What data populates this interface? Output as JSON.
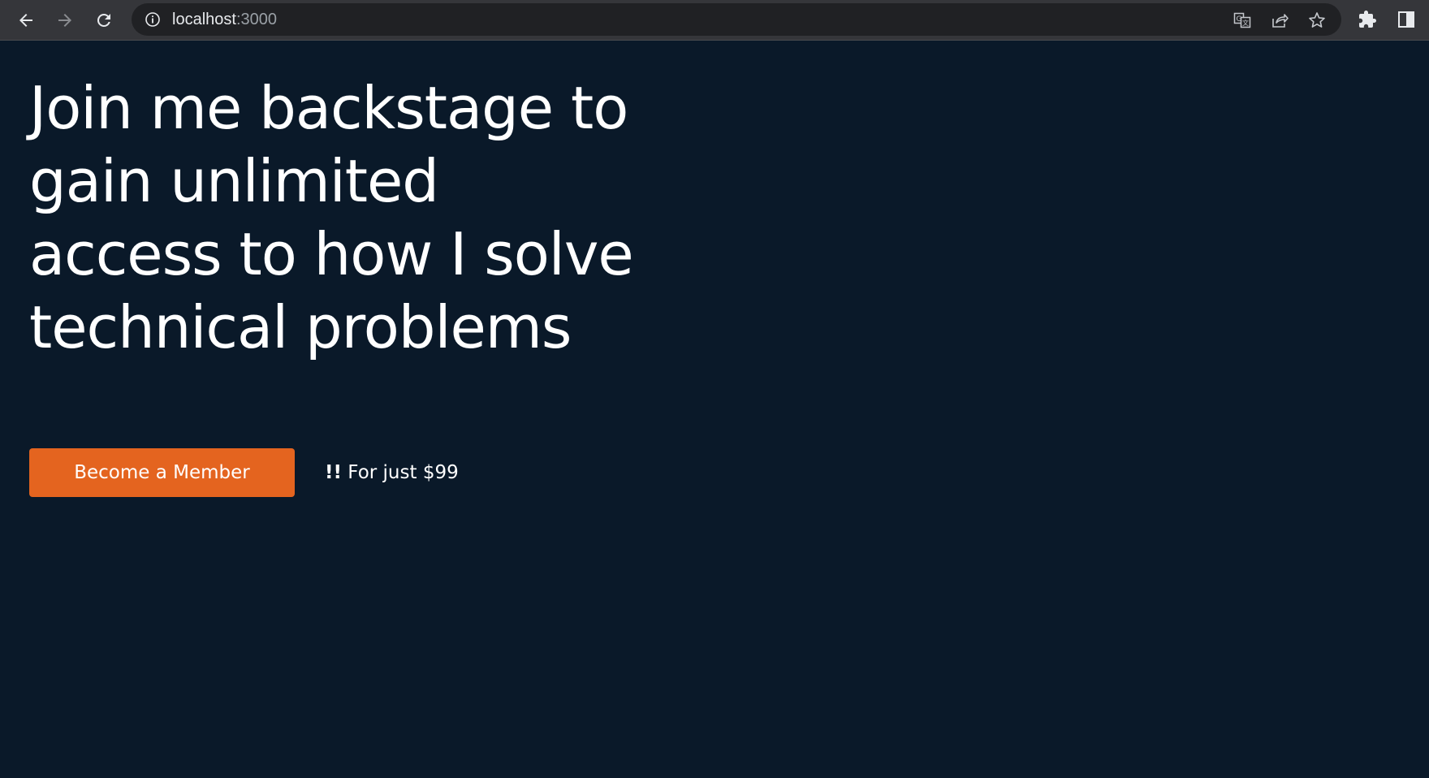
{
  "browser": {
    "url_host": "localhost",
    "url_port": ":3000"
  },
  "hero": {
    "headline": "Join me backstage to gain unlimited access to how I solve technical problems",
    "cta_label": "Become a Member",
    "price_emphasis": "!!",
    "price_text": " For just $99"
  },
  "colors": {
    "background": "#0a1929",
    "cta": "#e4641f",
    "browser_chrome": "#35363a"
  }
}
